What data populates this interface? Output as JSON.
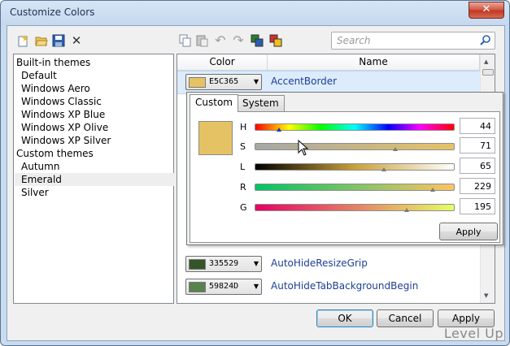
{
  "window": {
    "title": "Customize Colors",
    "close_glyph": "✕"
  },
  "toolbar": {
    "icons": [
      "new-theme-icon",
      "open-icon",
      "save-icon",
      "delete-icon",
      "copy-icon",
      "paste-icon",
      "undo-icon",
      "redo-icon",
      "swap-colors-icon",
      "reset-colors-icon"
    ],
    "delete_glyph": "✕",
    "undo_glyph": "↶",
    "redo_glyph": "↷"
  },
  "search": {
    "placeholder": "Search"
  },
  "themes": {
    "builtin_header": "Built-in themes",
    "builtin": [
      "Default",
      "Windows Aero",
      "Windows Classic",
      "Windows XP Blue",
      "Windows XP Olive",
      "Windows XP Silver"
    ],
    "custom_header": "Custom themes",
    "custom": [
      "Autumn",
      "Emerald",
      "Silver"
    ],
    "selected": "Emerald"
  },
  "grid": {
    "headers": {
      "color": "Color",
      "name": "Name"
    },
    "rows": [
      {
        "hex": "E5C365",
        "color": "#e5c365",
        "name": "AccentBorder"
      },
      {
        "hex": "335529",
        "color": "#335529",
        "name": "AutoHideResizeGrip"
      },
      {
        "hex": "59824D",
        "color": "#59824d",
        "name": "AutoHideTabBackgroundBegin"
      }
    ]
  },
  "picker": {
    "tabs": {
      "custom": "Custom",
      "system": "System"
    },
    "active_tab": "Custom",
    "preview_color": "#e5c365",
    "sliders": [
      {
        "label": "H",
        "value": "44",
        "fraction": 0.122
      },
      {
        "label": "S",
        "value": "71",
        "fraction": 0.71
      },
      {
        "label": "L",
        "value": "65",
        "fraction": 0.65
      },
      {
        "label": "R",
        "value": "229",
        "fraction": 0.898
      },
      {
        "label": "G",
        "value": "195",
        "fraction": 0.765
      }
    ],
    "apply_label": "Apply"
  },
  "buttons": {
    "ok": "OK",
    "cancel": "Cancel",
    "apply": "Apply"
  },
  "watermark": "Level Up"
}
